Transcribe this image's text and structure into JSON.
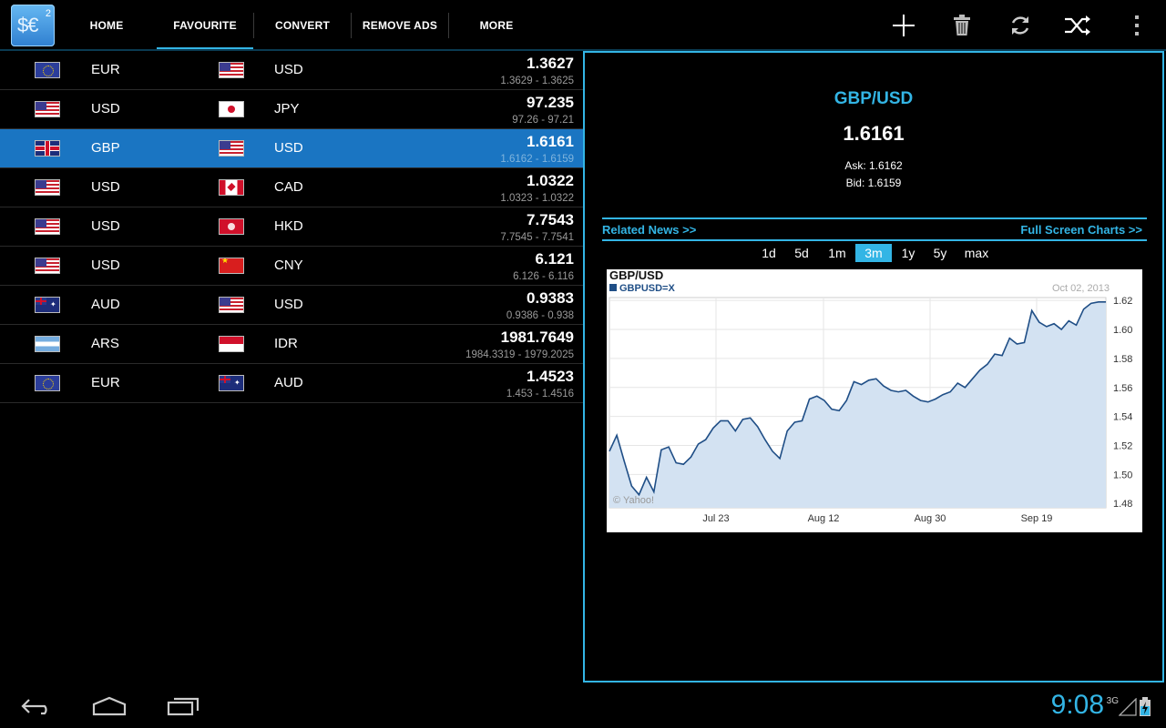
{
  "app": {
    "logo_text": "$€",
    "logo_sup": "2"
  },
  "tabs": [
    {
      "label": "HOME"
    },
    {
      "label": "FAVOURITE",
      "selected": true
    },
    {
      "label": "CONVERT"
    },
    {
      "label": "REMOVE ADS"
    },
    {
      "label": "MORE"
    }
  ],
  "actions": [
    "add-icon",
    "delete-icon",
    "refresh-icon",
    "shuffle-icon",
    "overflow-menu-icon"
  ],
  "rows": [
    {
      "from": "EUR",
      "from_flag": "f-eu",
      "to": "USD",
      "to_flag": "f-us",
      "rate": "1.3627",
      "range": "1.3629 - 1.3625"
    },
    {
      "from": "USD",
      "from_flag": "f-us",
      "to": "JPY",
      "to_flag": "f-jp",
      "rate": "97.235",
      "range": "97.26 - 97.21"
    },
    {
      "from": "GBP",
      "from_flag": "f-gb",
      "to": "USD",
      "to_flag": "f-us",
      "rate": "1.6161",
      "range": "1.6162 - 1.6159",
      "selected": true
    },
    {
      "from": "USD",
      "from_flag": "f-us",
      "to": "CAD",
      "to_flag": "f-ca",
      "rate": "1.0322",
      "range": "1.0323 - 1.0322"
    },
    {
      "from": "USD",
      "from_flag": "f-us",
      "to": "HKD",
      "to_flag": "f-hk",
      "rate": "7.7543",
      "range": "7.7545 - 7.7541"
    },
    {
      "from": "USD",
      "from_flag": "f-us",
      "to": "CNY",
      "to_flag": "f-cn",
      "rate": "6.121",
      "range": "6.126 - 6.116"
    },
    {
      "from": "AUD",
      "from_flag": "f-au",
      "to": "USD",
      "to_flag": "f-us",
      "rate": "0.9383",
      "range": "0.9386 - 0.938"
    },
    {
      "from": "ARS",
      "from_flag": "f-ar",
      "to": "IDR",
      "to_flag": "f-id",
      "rate": "1981.7649",
      "range": "1984.3319 - 1979.2025"
    },
    {
      "from": "EUR",
      "from_flag": "f-eu",
      "to": "AUD",
      "to_flag": "f-au",
      "rate": "1.4523",
      "range": "1.453 - 1.4516"
    }
  ],
  "detail": {
    "pair": "GBP/USD",
    "rate": "1.6161",
    "ask": "Ask: 1.6162",
    "bid": "Bid: 1.6159",
    "related_news": "Related News >>",
    "full_screen": "Full Screen Charts >>",
    "ranges": [
      {
        "label": "1d"
      },
      {
        "label": "5d"
      },
      {
        "label": "1m"
      },
      {
        "label": "3m",
        "selected": true
      },
      {
        "label": "1y"
      },
      {
        "label": "5y"
      },
      {
        "label": "max"
      }
    ]
  },
  "chart_data": {
    "type": "area",
    "title": "GBP/USD",
    "series_label": "GBPUSD=X",
    "date_label": "Oct 02, 2013",
    "credit": "© Yahoo!",
    "x_ticks": [
      "Jul 23",
      "Aug 12",
      "Aug 30",
      "Sep 19"
    ],
    "y_ticks": [
      "1.62",
      "1.60",
      "1.58",
      "1.56",
      "1.54",
      "1.52",
      "1.50",
      "1.48"
    ],
    "ylim": [
      1.477,
      1.622
    ],
    "colors": {
      "line": "#1f4e86",
      "fill": "#d3e2f2"
    },
    "values": [
      1.516,
      1.527,
      1.509,
      1.492,
      1.486,
      1.498,
      1.488,
      1.517,
      1.519,
      1.508,
      1.507,
      1.512,
      1.521,
      1.524,
      1.532,
      1.537,
      1.537,
      1.53,
      1.538,
      1.539,
      1.533,
      1.524,
      1.516,
      1.511,
      1.53,
      1.536,
      1.537,
      1.552,
      1.554,
      1.551,
      1.545,
      1.544,
      1.551,
      1.564,
      1.562,
      1.565,
      1.566,
      1.561,
      1.558,
      1.557,
      1.558,
      1.554,
      1.551,
      1.55,
      1.552,
      1.555,
      1.557,
      1.563,
      1.56,
      1.566,
      1.572,
      1.576,
      1.583,
      1.582,
      1.594,
      1.59,
      1.591,
      1.613,
      1.605,
      1.602,
      1.604,
      1.6,
      1.606,
      1.603,
      1.614,
      1.618,
      1.619,
      1.619
    ]
  },
  "system": {
    "clock": "9:08",
    "network": "3G"
  }
}
